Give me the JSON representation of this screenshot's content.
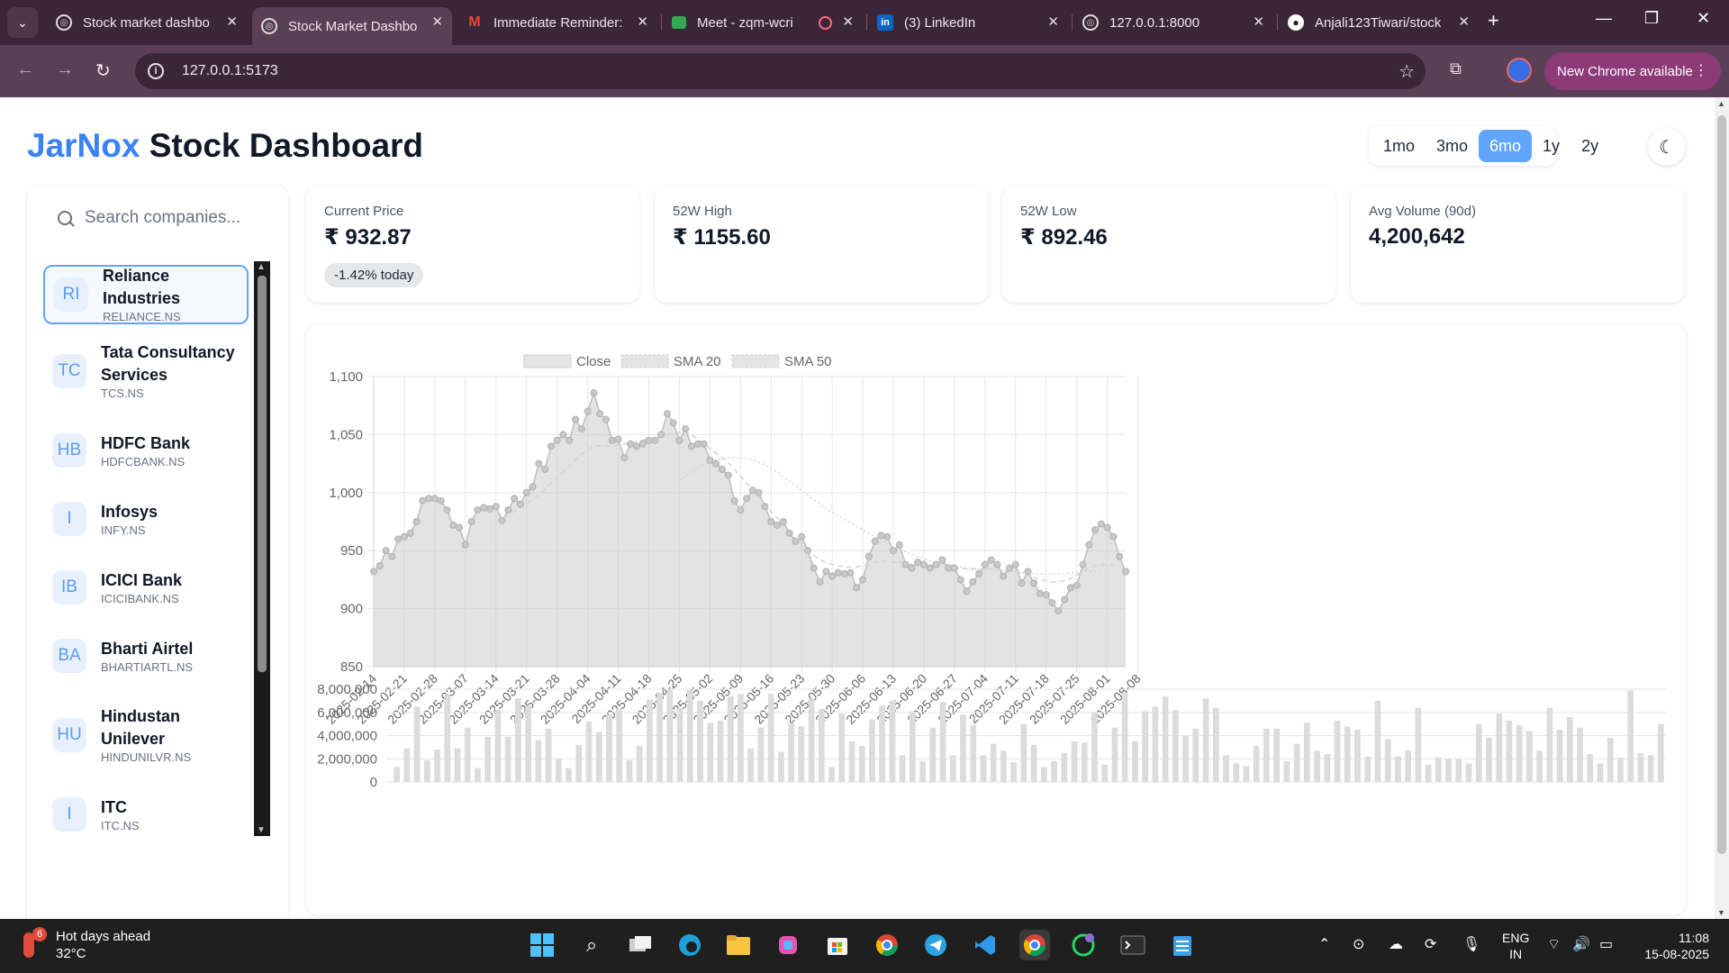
{
  "browser": {
    "tabs": [
      {
        "title": "Stock market dashbo",
        "icon": "globe-icon"
      },
      {
        "title": "Stock Market Dashbo",
        "icon": "globe-icon"
      },
      {
        "title": "Immediate Reminder:",
        "icon": "gmail-icon"
      },
      {
        "title": "Meet - zqm-wcri",
        "icon": "meet-icon"
      },
      {
        "title": "(3) LinkedIn",
        "icon": "linkedin-icon"
      },
      {
        "title": "127.0.0.1:8000",
        "icon": "globe-icon"
      },
      {
        "title": "Anjali123Tiwari/stock",
        "icon": "github-icon"
      }
    ],
    "active_tab": 1,
    "url": "127.0.0.1:5173",
    "update_label": "New Chrome available"
  },
  "app": {
    "title_brand": "JarNox",
    "title_rest": " Stock Dashboard",
    "ranges": [
      "1mo",
      "3mo",
      "6mo",
      "1y",
      "2y"
    ],
    "active_range": "6mo",
    "theme_icon": "moon-icon"
  },
  "search": {
    "placeholder": "Search companies..."
  },
  "companies": [
    {
      "initials": "RI",
      "name": "Reliance Industries",
      "symbol": "RELIANCE.NS"
    },
    {
      "initials": "TC",
      "name": "Tata Consultancy Services",
      "symbol": "TCS.NS"
    },
    {
      "initials": "HB",
      "name": "HDFC Bank",
      "symbol": "HDFCBANK.NS"
    },
    {
      "initials": "I",
      "name": "Infosys",
      "symbol": "INFY.NS"
    },
    {
      "initials": "IB",
      "name": "ICICI Bank",
      "symbol": "ICICIBANK.NS"
    },
    {
      "initials": "BA",
      "name": "Bharti Airtel",
      "symbol": "BHARTIARTL.NS"
    },
    {
      "initials": "HU",
      "name": "Hindustan Unilever",
      "symbol": "HINDUNILVR.NS"
    },
    {
      "initials": "I",
      "name": "ITC",
      "symbol": "ITC.NS"
    }
  ],
  "selected_company": 0,
  "stats": {
    "current_price": {
      "label": "Current Price",
      "value": "₹ 932.87",
      "change": "-1.42% today"
    },
    "high_52w": {
      "label": "52W High",
      "value": "₹ 1155.60"
    },
    "low_52w": {
      "label": "52W Low",
      "value": "₹ 892.46"
    },
    "avg_volume": {
      "label": "Avg Volume (90d)",
      "value": "4,200,642"
    }
  },
  "chart_data": [
    {
      "type": "line",
      "legend": [
        "Close",
        "SMA 20",
        "SMA 50"
      ],
      "legend_position": "top",
      "ylim": [
        850,
        1100
      ],
      "yticks": [
        "850",
        "900",
        "950",
        "1,000",
        "1,050",
        "1,100"
      ],
      "grid": true,
      "x_ticks": [
        "2025-02-14",
        "2025-02-21",
        "2025-02-28",
        "2025-03-07",
        "2025-03-14",
        "2025-03-21",
        "2025-03-28",
        "2025-04-04",
        "2025-04-11",
        "2025-04-18",
        "2025-04-25",
        "2025-05-02",
        "2025-05-09",
        "2025-05-16",
        "2025-05-23",
        "2025-05-30",
        "2025-06-06",
        "2025-06-13",
        "2025-06-20",
        "2025-06-27",
        "2025-07-04",
        "2025-07-11",
        "2025-07-18",
        "2025-07-25",
        "2025-08-01",
        "2025-08-08"
      ],
      "close": [
        932,
        937,
        950,
        945,
        960,
        962,
        965,
        975,
        993,
        995,
        995,
        993,
        985,
        972,
        970,
        955,
        975,
        985,
        987,
        986,
        988,
        976,
        985,
        995,
        990,
        1000,
        1005,
        1025,
        1020,
        1040,
        1045,
        1050,
        1045,
        1063,
        1055,
        1070,
        1086,
        1068,
        1063,
        1045,
        1046,
        1030,
        1042,
        1040,
        1042,
        1045,
        1045,
        1050,
        1068,
        1060,
        1045,
        1055,
        1040,
        1042,
        1042,
        1028,
        1025,
        1020,
        1015,
        993,
        985,
        995,
        1002,
        1000,
        988,
        975,
        972,
        975,
        965,
        958,
        962,
        950,
        935,
        923,
        932,
        928,
        931,
        930,
        931,
        918,
        925,
        945,
        958,
        963,
        962,
        950,
        955,
        938,
        935,
        940,
        938,
        935,
        938,
        942,
        935,
        935,
        925,
        915,
        923,
        930,
        938,
        942,
        938,
        928,
        935,
        938,
        922,
        932,
        922,
        913,
        912,
        905,
        898,
        908,
        918,
        920,
        938,
        955,
        968,
        973,
        970,
        962,
        945,
        932
      ],
      "sma20": [
        null,
        null,
        null,
        null,
        null,
        null,
        null,
        null,
        null,
        null,
        null,
        null,
        null,
        null,
        null,
        null,
        null,
        null,
        null,
        null,
        975,
        978,
        981,
        984,
        987,
        990,
        994,
        998,
        1003,
        1008,
        1013,
        1018,
        1023,
        1028,
        1033,
        1037,
        1040,
        1040,
        1040,
        1040,
        1041,
        1042,
        1043,
        1044,
        1045,
        1046,
        1047,
        1048,
        1050,
        1051,
        1052,
        1053,
        1050,
        1046,
        1042,
        1038,
        1034,
        1030,
        1026,
        1020,
        1014,
        1008,
        1002,
        996,
        990,
        984,
        978,
        972,
        966,
        960,
        955,
        950,
        946,
        942,
        940,
        938,
        937,
        936,
        936,
        936,
        937,
        938,
        940,
        941,
        941,
        940,
        940,
        939,
        938,
        937,
        937,
        937,
        937,
        937,
        936,
        936,
        935,
        934,
        934,
        934,
        934,
        934,
        934,
        933,
        933,
        932,
        931,
        929,
        927,
        925,
        924,
        923,
        923,
        924,
        926,
        929,
        932,
        935,
        937,
        938,
        938,
        937
      ],
      "sma50": [
        null,
        null,
        null,
        null,
        null,
        null,
        null,
        null,
        null,
        null,
        null,
        null,
        null,
        null,
        null,
        null,
        null,
        null,
        null,
        null,
        null,
        null,
        null,
        null,
        null,
        null,
        null,
        null,
        null,
        null,
        null,
        null,
        null,
        null,
        null,
        null,
        null,
        null,
        null,
        null,
        null,
        null,
        null,
        null,
        null,
        null,
        null,
        null,
        null,
        null,
        1010,
        1014,
        1018,
        1021,
        1024,
        1026,
        1028,
        1029,
        1030,
        1030,
        1030,
        1029,
        1028,
        1026,
        1024,
        1021,
        1018,
        1014,
        1010,
        1006,
        1002,
        998,
        994,
        990,
        986,
        983,
        980,
        977,
        974,
        971,
        968,
        965,
        962,
        959,
        956,
        953,
        951,
        949,
        947,
        945,
        943,
        941,
        940,
        939,
        938,
        937,
        936,
        935,
        935,
        934,
        934,
        934,
        933,
        933,
        932,
        932,
        931,
        931,
        930,
        930,
        930,
        930,
        930,
        930,
        931,
        931,
        932,
        932,
        932,
        933
      ]
    },
    {
      "type": "bar",
      "name": "Volume",
      "ylim": [
        0,
        8000000
      ],
      "yticks": [
        "0",
        "2,000,000",
        "4,000,000",
        "6,000,000",
        "8,000,000"
      ],
      "grid": true,
      "values": [
        1300000,
        2900000,
        6500000,
        1900000,
        2800000,
        7600000,
        2900000,
        4700000,
        1200000,
        3900000,
        6200000,
        3900000,
        7200000,
        6600000,
        3600000,
        4600000,
        2000000,
        1200000,
        3200000,
        5200000,
        4300000,
        5800000,
        6300000,
        1900000,
        3100000,
        7100000,
        7700000,
        8000000,
        6400000,
        7900000,
        7000000,
        5100000,
        5300000,
        7400000,
        7600000,
        2900000,
        4700000,
        7600000,
        2600000,
        5100000,
        4800000,
        7200000,
        6300000,
        1300000,
        5900000,
        3500000,
        3100000,
        5400000,
        6600000,
        7000000,
        2300000,
        6100000,
        1800000,
        4700000,
        6900000,
        2300000,
        5800000,
        4900000,
        2300000,
        3300000,
        2700000,
        1700000,
        5000000,
        3200000,
        1300000,
        1800000,
        2500000,
        3500000,
        3400000,
        6000000,
        1500000,
        4700000,
        7700000,
        3500000,
        6100000,
        6500000,
        7400000,
        6200000,
        4000000,
        4600000,
        7200000,
        6400000,
        2300000,
        1600000,
        1400000,
        3100000,
        4600000,
        4600000,
        1800000,
        3300000,
        5100000,
        2700000,
        2400000,
        5300000,
        4800000,
        4500000,
        2200000,
        7000000,
        3700000,
        2200000,
        2700000,
        6400000,
        1500000,
        2100000,
        2000000,
        2000000,
        1600000,
        5000000,
        3800000,
        5900000,
        5300000,
        4900000,
        4400000,
        2700000,
        6400000,
        4500000,
        5600000,
        4700000,
        2400000,
        1600000,
        3800000,
        2100000,
        7900000,
        2500000,
        2300000,
        5000000
      ]
    }
  ],
  "taskbar": {
    "weather_title": "Hot days ahead",
    "weather_temp": "32°C",
    "weather_badge": "6",
    "lang_1": "ENG",
    "lang_2": "IN",
    "time": "11:08",
    "date": "15-08-2025"
  }
}
